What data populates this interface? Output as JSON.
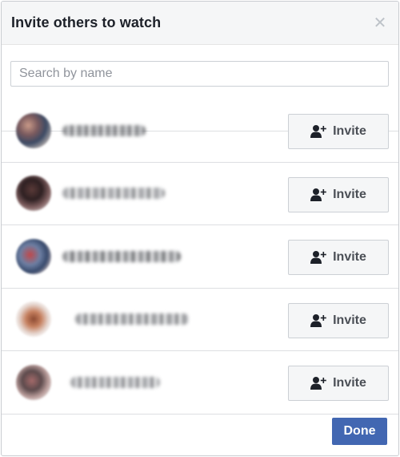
{
  "dialog": {
    "title": "Invite others to watch",
    "close_icon": "close-icon"
  },
  "search": {
    "placeholder": "Search by name",
    "value": ""
  },
  "people": [
    {
      "invite_label": "Invite",
      "icon": "add-person-icon"
    },
    {
      "invite_label": "Invite",
      "icon": "add-person-icon"
    },
    {
      "invite_label": "Invite",
      "icon": "add-person-icon"
    },
    {
      "invite_label": "Invite",
      "icon": "add-person-icon"
    },
    {
      "invite_label": "Invite",
      "icon": "add-person-icon"
    }
  ],
  "footer": {
    "done_label": "Done"
  },
  "colors": {
    "accent": "#4267b2",
    "header_bg": "#f5f6f7",
    "border": "#dddfe2"
  }
}
